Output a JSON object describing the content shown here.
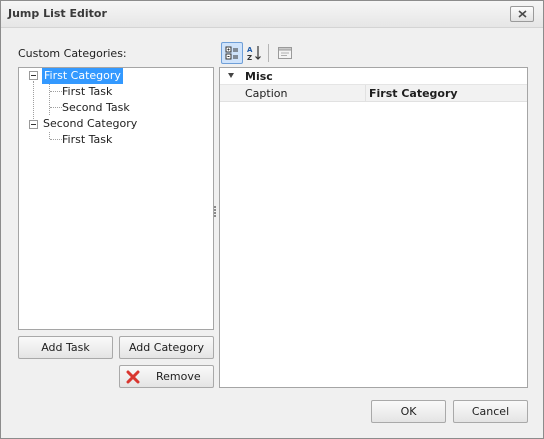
{
  "window": {
    "title": "Jump List Editor"
  },
  "categories_label": "Custom Categories:",
  "tree": [
    {
      "label": "First Category",
      "selected": true,
      "children": [
        "First Task",
        "Second Task"
      ]
    },
    {
      "label": "Second Category",
      "selected": false,
      "children": [
        "First Task"
      ]
    }
  ],
  "buttons": {
    "add_task": "Add Task",
    "add_category": "Add Category",
    "remove": "Remove",
    "ok": "OK",
    "cancel": "Cancel"
  },
  "toolbar": {
    "icons": [
      "categorized-view-icon",
      "alphabetical-sort-icon",
      "property-pages-icon"
    ],
    "active": "categorized-view-icon"
  },
  "property_grid": {
    "category": "Misc",
    "rows": [
      {
        "name": "Caption",
        "value": "First Category"
      }
    ]
  },
  "colors": {
    "selection": "#3399ff",
    "remove_icon": "#d9362f"
  }
}
